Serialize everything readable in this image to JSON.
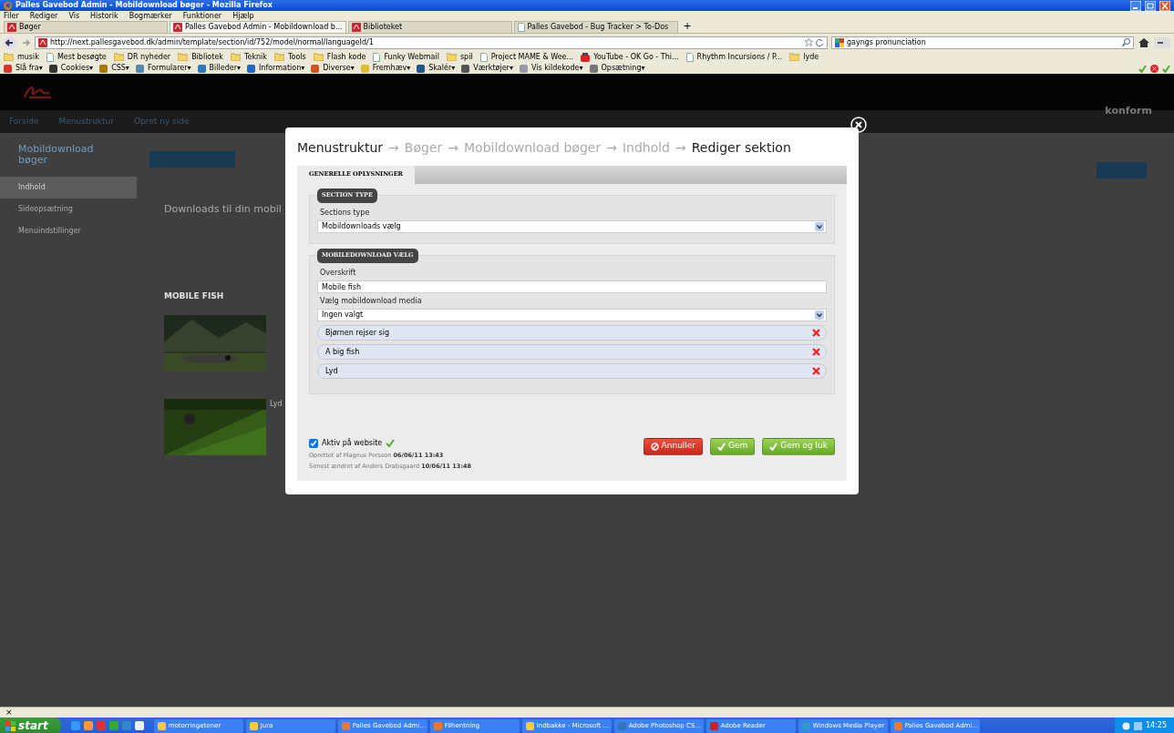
{
  "window": {
    "title": "Palles Gavebod Admin - Mobildownload bøger - Mozilla Firefox"
  },
  "menu": [
    "Filer",
    "Rediger",
    "Vis",
    "Historik",
    "Bogmærker",
    "Funktioner",
    "Hjælp"
  ],
  "tabs": [
    {
      "label": "Bøger",
      "selected": false,
      "kind": "site"
    },
    {
      "label": "Palles Gavebod Admin - Mobildownload b...",
      "selected": true,
      "kind": "site"
    },
    {
      "label": "Biblioteket",
      "selected": false,
      "kind": "site"
    },
    {
      "label": "Palles Gavebod - Bug Tracker > To-Dos",
      "selected": false,
      "kind": "page"
    }
  ],
  "new_tab": "+",
  "address": {
    "url": "http://next.pallesgavebod.dk/admin/template/section/id/752/model/normal/languageId/1"
  },
  "search": {
    "value": "gayngs pronunciation"
  },
  "bookmarks": [
    {
      "label": "musik",
      "kind": "folder"
    },
    {
      "label": "Mest besøgte",
      "kind": "page"
    },
    {
      "label": "DR nyheder",
      "kind": "folder"
    },
    {
      "label": "Bibliotek",
      "kind": "folder"
    },
    {
      "label": "Teknik",
      "kind": "folder"
    },
    {
      "label": "Tools",
      "kind": "folder"
    },
    {
      "label": "Flash kode",
      "kind": "folder"
    },
    {
      "label": "Funky Webmail",
      "kind": "page"
    },
    {
      "label": "spil",
      "kind": "folder"
    },
    {
      "label": "Project MAME & Wee...",
      "kind": "page"
    },
    {
      "label": "YouTube - OK Go - Thi...",
      "kind": "video"
    },
    {
      "label": "Rhythm Incursions / P...",
      "kind": "page"
    },
    {
      "label": "lyde",
      "kind": "folder"
    }
  ],
  "dev_toolbar": [
    "Slå fra▾",
    "Cookies▾",
    "CSS▾",
    "Formularer▾",
    "Billeder▾",
    "Information▾",
    "Diverse▾",
    "Fremhæv▾",
    "Skalér▾",
    "Værktøjer▾",
    "Vis kildekode▾",
    "Opsætning▾"
  ],
  "page": {
    "nav": [
      "Forside",
      "Menustruktur",
      "Opret ny side"
    ],
    "brand": "konform",
    "sidebar": {
      "title": "Mobildownload bøger",
      "items": [
        {
          "label": "Indhold",
          "selected": true
        },
        {
          "label": "Sideopsætning",
          "selected": false
        },
        {
          "label": "Menuindstillinger",
          "selected": false
        }
      ]
    },
    "intro": "Downloads til din mobil",
    "section_title": "MOBILE FISH",
    "media": [
      {
        "kind": "picture"
      },
      {
        "kind": "picture",
        "caption": "Lyd"
      }
    ]
  },
  "modal": {
    "breadcrumb": [
      {
        "label": "Menustruktur",
        "current": true
      },
      {
        "label": "Bøger",
        "current": false
      },
      {
        "label": "Mobildownload bøger",
        "current": false
      },
      {
        "label": "Indhold",
        "current": false
      },
      {
        "label": "Rediger sektion",
        "current": true
      }
    ],
    "separator": "→",
    "tabs": [
      {
        "label": "GENERELLE OPLYSNINGER",
        "selected": true
      }
    ],
    "fieldsets": [
      {
        "legend": "SECTION TYPE",
        "fields": [
          {
            "kind": "select",
            "label": "Sections type",
            "value": "Mobildownloads vælg"
          }
        ]
      },
      {
        "legend": "MOBILEDOWNLOAD VÆLG",
        "fields": [
          {
            "kind": "text",
            "label": "Overskrift",
            "value": "Mobile fish"
          },
          {
            "kind": "select",
            "label": "Vælg mobildownload media",
            "value": "Ingen valgt"
          },
          {
            "kind": "items",
            "items": [
              "Bjørnen rejser sig",
              "A big fish",
              "Lyd"
            ]
          }
        ]
      }
    ],
    "active": {
      "label": "Aktiv på website",
      "checked": true
    },
    "meta": [
      "Oprettet af Magnus Persson **06/06/11 13:43**",
      "Senest ændret af Anders Drabsgaard **10/06/11 13:48**"
    ],
    "buttons": [
      {
        "label": "Annuller",
        "kind": "cancel"
      },
      {
        "label": "Gem",
        "kind": "save"
      },
      {
        "label": "Gem og luk",
        "kind": "save"
      }
    ]
  },
  "find_bar": {
    "close": "×"
  },
  "taskbar": {
    "start": "start",
    "items": [
      "motorringetoner",
      "Jura",
      "Palles Gavebod Admi...",
      "Filhentning",
      "Indbakke - Microsoft ...",
      "Adobe Photoshop CS...",
      "Adobe Reader",
      "Windows Media Player",
      "Palles Gavebod Admi..."
    ],
    "clock": "14:25"
  }
}
